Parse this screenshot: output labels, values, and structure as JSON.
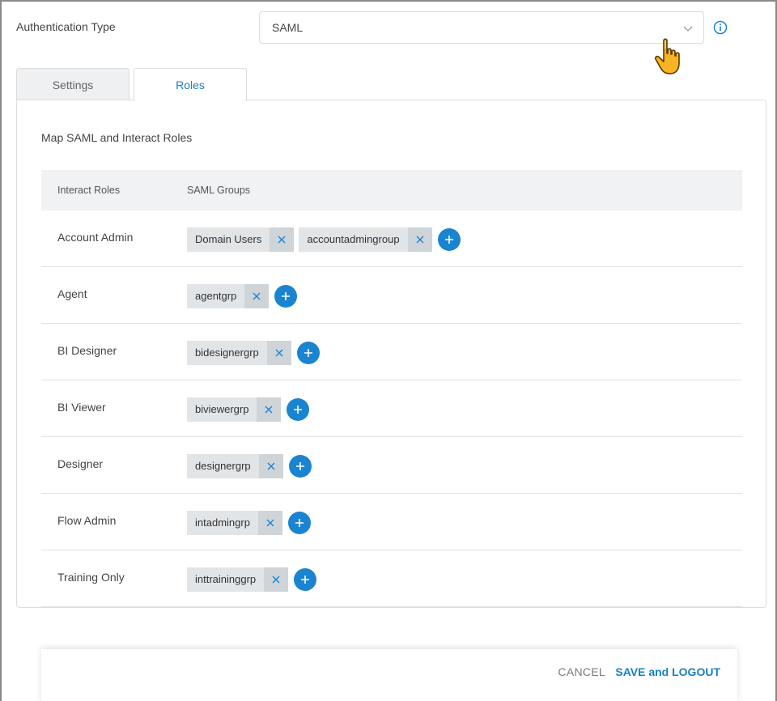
{
  "auth": {
    "label": "Authentication Type",
    "selected": "SAML"
  },
  "icons": {
    "chevron": "chevron-down-icon",
    "info": "info-icon",
    "cursor": "hand-pointer-icon",
    "remove": "close-icon",
    "add": "plus-icon"
  },
  "tabs": [
    {
      "label": "Settings",
      "active": false
    },
    {
      "label": "Roles",
      "active": true
    }
  ],
  "panel": {
    "title": "Map SAML and Interact Roles"
  },
  "table": {
    "headers": {
      "roles": "Interact Roles",
      "groups": "SAML Groups"
    },
    "rows": [
      {
        "role": "Account Admin",
        "groups": [
          "Domain Users",
          "accountadmingroup"
        ]
      },
      {
        "role": "Agent",
        "groups": [
          "agentgrp"
        ]
      },
      {
        "role": "BI Designer",
        "groups": [
          "bidesignergrp"
        ]
      },
      {
        "role": "BI Viewer",
        "groups": [
          "biviewergrp"
        ]
      },
      {
        "role": "Designer",
        "groups": [
          "designergrp"
        ]
      },
      {
        "role": "Flow Admin",
        "groups": [
          "intadmingrp"
        ]
      },
      {
        "role": "Training Only",
        "groups": [
          "inttraininggrp"
        ]
      }
    ]
  },
  "footer": {
    "cancel": "CANCEL",
    "save": "SAVE and LOGOUT"
  },
  "colors": {
    "accent": "#1a84d0",
    "chip_bg": "#e2e5e8",
    "chip_remove_bg": "#cfd4d9"
  }
}
